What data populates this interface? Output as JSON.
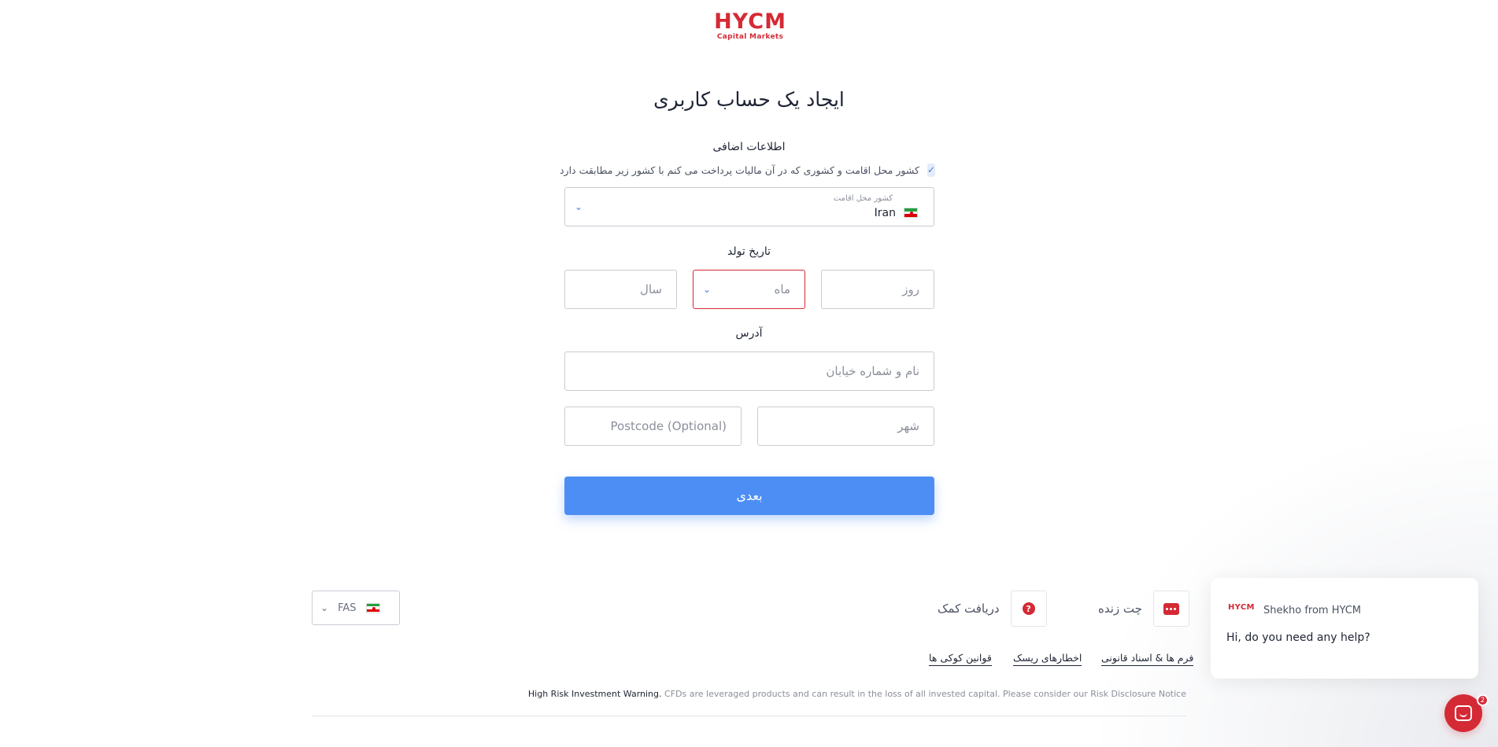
{
  "brand": {
    "logo_main": "HYCM",
    "logo_sub": "Capital Markets",
    "color": "#d42a35"
  },
  "page": {
    "title": "ایجاد یک حساب کاربری"
  },
  "additional_info": {
    "label": "اطلاعات اضافی",
    "checkbox_text": "کشور محل اقامت و کشوری که در آن مالیات پرداخت می کنم با کشور زیر مطابقت دارد",
    "checkbox_checked": true
  },
  "country": {
    "label": "کشور محل اقامت",
    "value": "Iran",
    "flag_icon": "iran-flag-icon"
  },
  "birthdate": {
    "label": "تاریخ تولد",
    "day_placeholder": "روز",
    "month_placeholder": "ماه",
    "year_placeholder": "سال"
  },
  "address": {
    "label": "آدرس",
    "street_placeholder": "نام و شماره خیابان",
    "city_placeholder": "شهر",
    "postcode_placeholder": "Postcode (Optional)"
  },
  "next_button": {
    "label": "بعدی",
    "color": "#4d8ef5"
  },
  "footer": {
    "language": {
      "code": "FAS"
    },
    "live_chat": "چت زنده",
    "get_help": "دریافت کمک",
    "links": [
      "فرم ها & اسناد قانونی",
      "اخطارهای ریسک",
      "قوانین کوکی ها"
    ],
    "warning_bold": "High Risk Investment Warning.",
    "warning_text": "CFDs are leveraged products and can result in the loss of all invested capital. Please consider our Risk Disclosure Notice"
  },
  "chat_widget": {
    "logo": "HYCM",
    "sender": "Shekho from HYCM",
    "message": "Hi, do you need any help?",
    "unread_count": "2"
  }
}
